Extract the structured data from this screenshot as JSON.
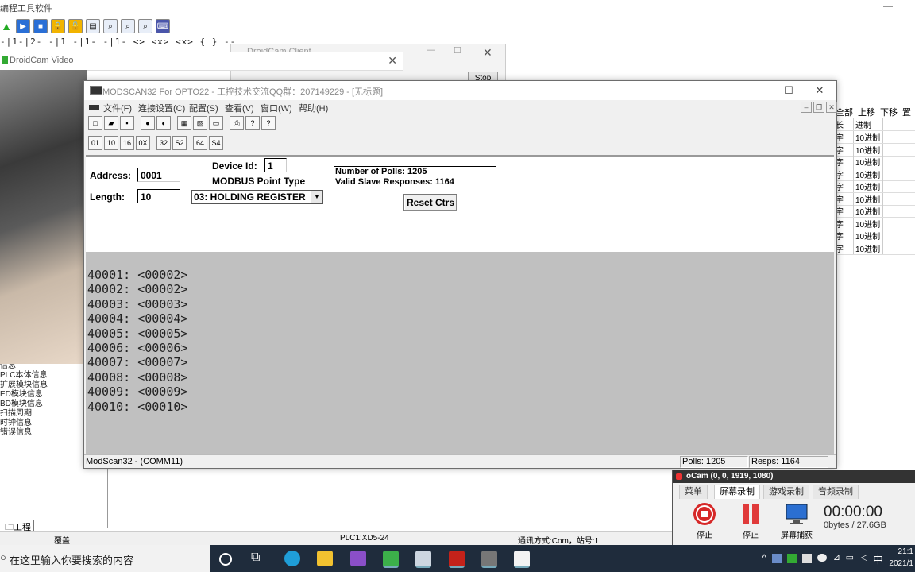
{
  "background_app": {
    "title": "编程工具软件",
    "ladder_symbols": "-|1-|2- -|1 -|1- -|1- <> <x> <x> { } -- -X-",
    "right_panel": {
      "headers": [
        "全部",
        "上移",
        "下移",
        "置"
      ],
      "sub_headers": [
        "长",
        "进制"
      ],
      "rows": [
        {
          "a": "字",
          "b": "10进制"
        },
        {
          "a": "字",
          "b": "10进制"
        },
        {
          "a": "字",
          "b": "10进制"
        },
        {
          "a": "字",
          "b": "10进制"
        },
        {
          "a": "字",
          "b": "10进制"
        },
        {
          "a": "字",
          "b": "10进制"
        },
        {
          "a": "字",
          "b": "10进制"
        },
        {
          "a": "字",
          "b": "10进制"
        },
        {
          "a": "字",
          "b": "10进制"
        },
        {
          "a": "字",
          "b": "10进制"
        }
      ]
    },
    "tree_items": [
      "信息",
      "PLC本体信息",
      "扩展模块信息",
      "ED模块信息",
      "BD模块信息",
      "扫描周期",
      "时钟信息",
      "错误信息"
    ],
    "project_tab": "工程",
    "status": {
      "mode": "覆盖",
      "plc": "PLC1:XD5-24",
      "comm": "通讯方式:Com，站号:1"
    }
  },
  "droidcam_video": {
    "title": "DroidCam Video"
  },
  "droidcam_client": {
    "title": "DroidCam Client",
    "stop_label": "Stop"
  },
  "modscan": {
    "title": "MODSCAN32 For OPTO22 - 工控技术交流QQ群：207149229 - [无标题]",
    "menu": [
      "文件(F)",
      "连接设置(C)",
      "配置(S)",
      "查看(V)",
      "窗口(W)",
      "帮助(H)"
    ],
    "address_label": "Address:",
    "address_value": "0001",
    "length_label": "Length:",
    "length_value": "10",
    "device_id_label": "Device Id:",
    "device_id_value": "1",
    "point_type_label": "MODBUS Point Type",
    "point_type_value": "03: HOLDING REGISTER",
    "polls_text": "Number of Polls: 1205",
    "responses_text": "Valid Slave Responses: 1164",
    "reset_label": "Reset Ctrs",
    "registers": [
      "40001: <00002>",
      "40002: <00002>",
      "40003: <00003>",
      "40004: <00004>",
      "40005: <00005>",
      "40006: <00006>",
      "40007: <00007>",
      "40008: <00008>",
      "40009: <00009>",
      "40010: <00010>"
    ],
    "status_left": "ModScan32 - (COMM11)",
    "status_polls": "Polls: 1205",
    "status_resps": "Resps: 1164"
  },
  "ocam": {
    "title": "oCam (0, 0, 1919, 1080)",
    "tabs": [
      "菜单",
      "屏幕录制",
      "游戏录制",
      "音频录制"
    ],
    "buttons": [
      "停止",
      "停止",
      "屏幕捕获"
    ],
    "time": "00:00:00",
    "size": "0bytes / 27.6GB"
  },
  "taskbar": {
    "search_placeholder": "在这里输入你要搜索的内容",
    "ime": "中",
    "clock_time": "21:1",
    "clock_date": "2021/1"
  }
}
